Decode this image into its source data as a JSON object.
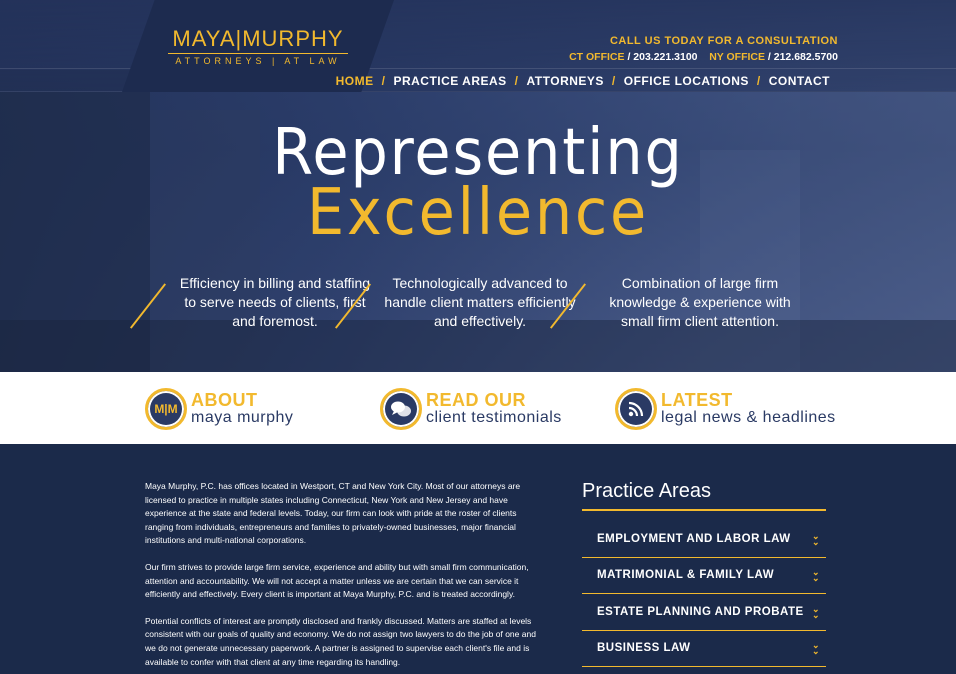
{
  "colors": {
    "accent": "#f2b92e",
    "navy": "#1b2a4a",
    "strip_bg": "#ffffff"
  },
  "header": {
    "logo_main": "MAYA|MURPHY",
    "logo_sub": "ATTORNEYS | AT LAW",
    "cta_headline": "CALL US TODAY FOR A CONSULTATION",
    "ct_label": "CT OFFICE",
    "ct_phone": "/ 203.221.3100",
    "ny_label": "NY OFFICE",
    "ny_phone": "/ 212.682.5700"
  },
  "nav": {
    "items": [
      {
        "label": "HOME"
      },
      {
        "label": "PRACTICE AREAS"
      },
      {
        "label": "ATTORNEYS"
      },
      {
        "label": "OFFICE LOCATIONS"
      },
      {
        "label": "CONTACT"
      }
    ],
    "separator": "/"
  },
  "hero": {
    "line1": "Representing",
    "line2": "Excellence",
    "features": [
      {
        "text": "Efficiency in billing and staffing to serve needs of clients, first and foremost."
      },
      {
        "text": "Technologically advanced to handle client matters efficiently and effectively."
      },
      {
        "text": "Combination of large firm knowledge & experience with small firm client attention."
      }
    ]
  },
  "strip": {
    "items": [
      {
        "icon": "mm-monogram-icon",
        "icon_text": "M|M",
        "title": "ABOUT",
        "sub": "maya murphy"
      },
      {
        "icon": "speech-bubbles-icon",
        "title": "READ OUR",
        "sub": "client testimonials"
      },
      {
        "icon": "rss-feed-icon",
        "title": "LATEST",
        "sub": "legal news & headlines"
      }
    ]
  },
  "content": {
    "paragraphs": [
      "Maya Murphy, P.C. has offices located in Westport, CT and New York City.  Most of our attorneys are licensed to practice in multiple states including Connecticut, New York and New Jersey and have experience at the state and federal levels. Today, our firm can look with pride at the roster of clients ranging from individuals, entrepreneurs and families to privately-owned businesses, major financial institutions and multi-national corporations.",
      "Our firm strives to provide large firm service, experience and ability but with small firm communication, attention and accountability. We will not accept a matter unless we are certain that we can service it efficiently and effectively. Every client is important at Maya Murphy, P.C. and is treated accordingly.",
      "Potential conflicts of interest are promptly disclosed and frankly discussed. Matters are staffed at levels consistent with our goals of quality and economy. We do not assign two lawyers to do the job of one and we do not generate unnecessary paperwork. A partner is assigned to supervise each client's file and is available to confer with that client at any time regarding its handling."
    ]
  },
  "practice_areas": {
    "title": "Practice Areas",
    "items": [
      {
        "label": "EMPLOYMENT AND LABOR LAW"
      },
      {
        "label": "MATRIMONIAL & FAMILY LAW"
      },
      {
        "label": "ESTATE PLANNING AND PROBATE"
      },
      {
        "label": "BUSINESS LAW"
      }
    ]
  }
}
